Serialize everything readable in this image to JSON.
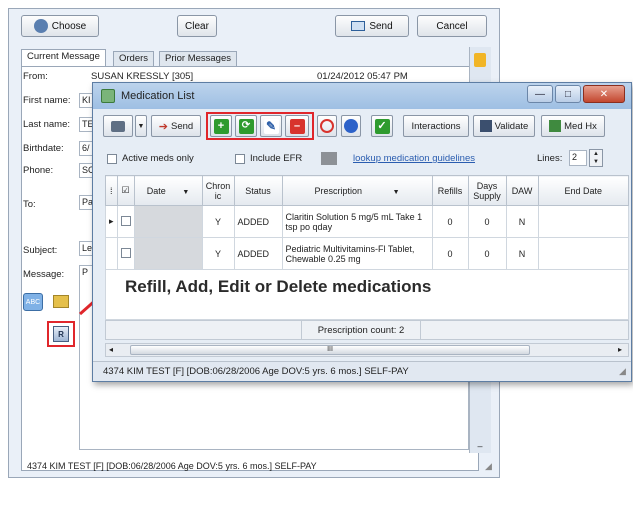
{
  "back": {
    "choose_label": "Choose",
    "clear_label": "Clear",
    "send_label": "Send",
    "cancel_label": "Cancel",
    "tabs": [
      "Current Message",
      "Orders",
      "Prior Messages"
    ],
    "from_label": "From:",
    "from_value": "SUSAN KRESSLY [305]",
    "datetime": "01/24/2012 05:47 PM",
    "first_name_label": "First name:",
    "first_name_value": "KI",
    "last_name_label": "Last name:",
    "last_name_value": "TE",
    "birthdate_label": "Birthdate:",
    "birthdate_value": "6/",
    "phone_label": "Phone:",
    "phone_value": "SC",
    "to_label": "To:",
    "to_value": "Pa",
    "subject_label": "Subject:",
    "subject_value": "Le",
    "message_label": "Message:",
    "message_value": "P",
    "status_text": "4374 KIM TEST [F] [DOB:06/28/2006  Age DOV:5 yrs. 6 mos.] SELF-PAY"
  },
  "modal": {
    "title": "Medication List",
    "toolbar": {
      "send_label": "Send",
      "interactions_label": "Interactions",
      "validate_label": "Validate",
      "medhx_label": "Med Hx"
    },
    "active_meds_label": "Active meds only",
    "include_efr_label": "Include EFR",
    "lookup_link": "lookup medication guidelines",
    "lines_label": "Lines:",
    "lines_value": "2",
    "columns": {
      "date": "Date",
      "chronic": "Chron ic",
      "status": "Status",
      "prescription": "Prescription",
      "refills": "Refills",
      "days_supply": "Days Supply",
      "daw": "DAW",
      "end_date": "End Date"
    },
    "rows": [
      {
        "chronic": "Y",
        "status": "ADDED",
        "prescription": "Claritin Solution 5 mg/5 mL Take 1 tsp po qday",
        "refills": "0",
        "days_supply": "0",
        "daw": "N",
        "end_date": ""
      },
      {
        "chronic": "Y",
        "status": "ADDED",
        "prescription": "Pediatric Multivitamins-Fl Tablet, Chewable 0.25 mg",
        "refills": "0",
        "days_supply": "0",
        "daw": "N",
        "end_date": ""
      }
    ],
    "annotation": "Refill, Add, Edit or Delete medications",
    "prescription_count": "Prescription count: 2",
    "scroll_grip": "III",
    "status_text": "4374 KIM TEST [F] [DOB:06/28/2006  Age DOV:5 yrs. 6 mos.] SELF-PAY"
  },
  "colors": {
    "accent_red": "#e0262b",
    "add_green": "#2e9b2e",
    "title_blue": "#9ebfe3"
  }
}
